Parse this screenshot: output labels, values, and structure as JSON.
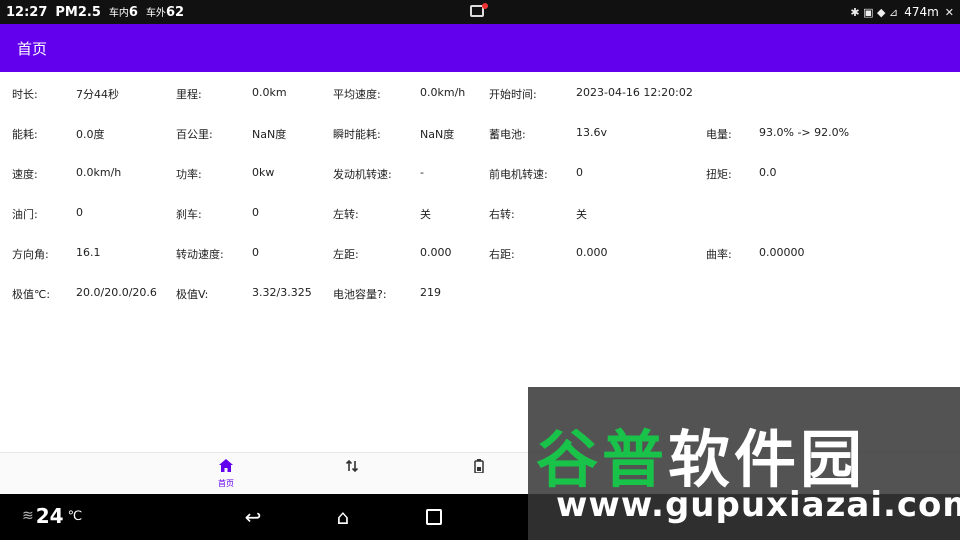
{
  "statusbar": {
    "time": "12:27",
    "pm_label": "PM2.5",
    "inside_label": "车内",
    "inside_value": "6",
    "outside_label": "车外",
    "outside_value": "62",
    "network": "474m",
    "signal_glyphs": "✱ ▣ ◆ ⊿",
    "mute_glyph": "✕"
  },
  "appbar": {
    "title": "首页"
  },
  "rows": [
    {
      "cells": [
        {
          "label": "时长:",
          "value": "7分44秒"
        },
        {
          "label": "里程:",
          "value": "0.0km"
        },
        {
          "label": "平均速度:",
          "value": "0.0km/h"
        },
        {
          "label": "开始时间:",
          "value": "2023-04-16 12:20:02"
        },
        {
          "label": "",
          "value": ""
        }
      ]
    },
    {
      "cells": [
        {
          "label": "能耗:",
          "value": "0.0度"
        },
        {
          "label": "百公里:",
          "value": "NaN度"
        },
        {
          "label": "瞬时能耗:",
          "value": "NaN度"
        },
        {
          "label": "蓄电池:",
          "value": "13.6v"
        },
        {
          "label": "电量:",
          "value": "93.0% -> 92.0%"
        }
      ]
    },
    {
      "cells": [
        {
          "label": "速度:",
          "value": "0.0km/h"
        },
        {
          "label": "功率:",
          "value": "0kw"
        },
        {
          "label": "发动机转速:",
          "value": "-"
        },
        {
          "label": "前电机转速:",
          "value": "0"
        },
        {
          "label": "扭矩:",
          "value": "0.0"
        }
      ]
    },
    {
      "cells": [
        {
          "label": "油门:",
          "value": "0"
        },
        {
          "label": "刹车:",
          "value": "0"
        },
        {
          "label": "左转:",
          "value": "关"
        },
        {
          "label": "右转:",
          "value": "关"
        },
        {
          "label": "",
          "value": ""
        }
      ]
    },
    {
      "cells": [
        {
          "label": "方向角:",
          "value": "16.1"
        },
        {
          "label": "转动速度:",
          "value": "0"
        },
        {
          "label": "左距:",
          "value": "0.000"
        },
        {
          "label": "右距:",
          "value": "0.000"
        },
        {
          "label": "曲率:",
          "value": "0.00000"
        }
      ]
    },
    {
      "cells": [
        {
          "label": "极值℃:",
          "value": "20.0/20.0/20.6"
        },
        {
          "label": "极值V:",
          "value": "3.32/3.325"
        },
        {
          "label": "电池容量?:",
          "value": "219"
        },
        {
          "label": "",
          "value": ""
        },
        {
          "label": "",
          "value": ""
        }
      ]
    }
  ],
  "bottomnav": {
    "home": {
      "label": "首页",
      "icon": "home-icon"
    },
    "swap": {
      "icon": "swap-icon"
    },
    "battery": {
      "icon": "battery-icon"
    }
  },
  "sysnav": {
    "temperature": "24",
    "temp_unit": "℃",
    "fan_glyph": "≋",
    "back_glyph": "↩",
    "home_glyph": "⌂"
  },
  "watermark": {
    "cn_part1": "谷普",
    "cn_part2": "软件园",
    "en": "www.gupuxiazai.com"
  },
  "colors": {
    "accent": "#6200ee",
    "statusbar": "#111111",
    "watermark_green": "#19c34a"
  }
}
